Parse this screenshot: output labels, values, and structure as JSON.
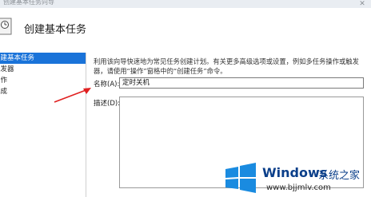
{
  "window": {
    "title": "创建基本任务向导"
  },
  "header": {
    "title": "创建基本任务"
  },
  "sidebar": {
    "items": [
      {
        "label": "创建基本任务"
      },
      {
        "label": "触发器"
      },
      {
        "label": "操作"
      },
      {
        "label": "完成"
      }
    ]
  },
  "main": {
    "description": "利用该向导快速地为常见任务创建计划。有关更多高级选项或设置，例如多任务操作或触发器，请使用“操作”窗格中的“创建任务”命令。",
    "name_label": "名称(A):",
    "name_value": "定时关机",
    "desc_label": "描述(D):",
    "desc_value": ""
  },
  "watermark": {
    "brand": "Windows",
    "sub": "系统之家",
    "url": "www.bjjmlv.com"
  }
}
